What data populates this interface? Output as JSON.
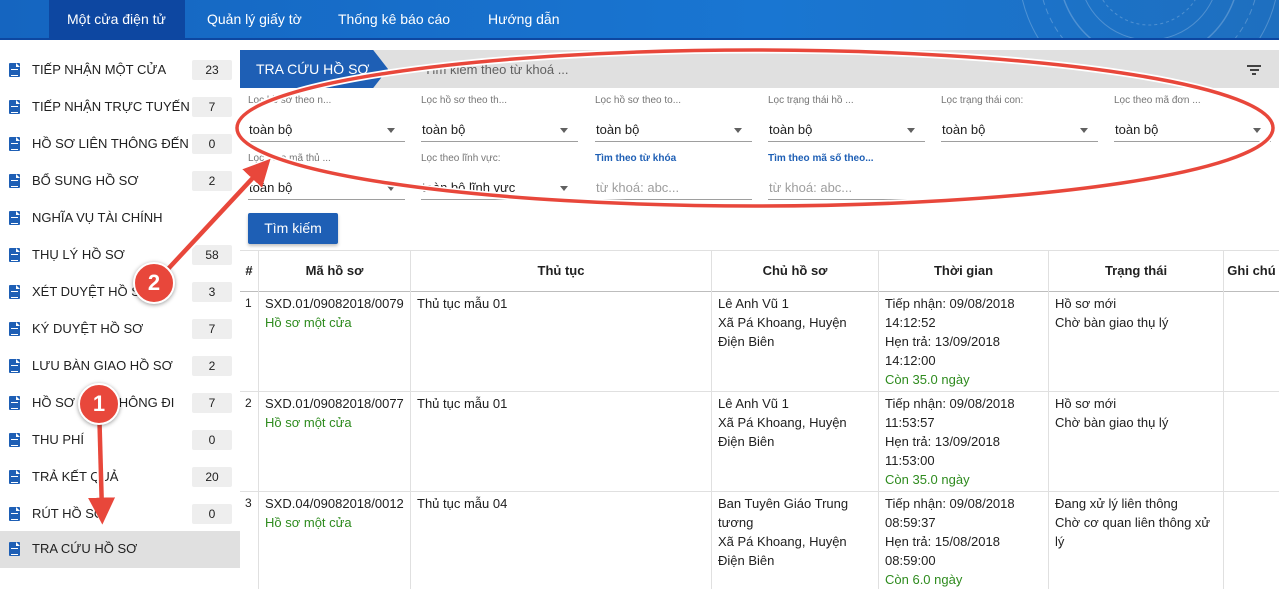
{
  "topnav": {
    "items": [
      "Một cửa điện tử",
      "Quản lý giấy tờ",
      "Thống kê báo cáo",
      "Hướng dẫn"
    ]
  },
  "sidebar": {
    "items": [
      {
        "label": "TIẾP NHẬN MỘT CỬA",
        "count": "23"
      },
      {
        "label": "TIẾP NHẬN TRỰC TUYẾN",
        "count": "7"
      },
      {
        "label": "HỒ SƠ LIÊN THÔNG ĐẾN",
        "count": "0"
      },
      {
        "label": "BỔ SUNG HỒ SƠ",
        "count": "2"
      },
      {
        "label": "NGHĨA VỤ TÀI CHÍNH",
        "count": ""
      },
      {
        "label": "THỤ LÝ HỒ SƠ",
        "count": "58"
      },
      {
        "label": "XÉT DUYỆT HỒ SƠ",
        "count": "3"
      },
      {
        "label": "KÝ DUYỆT HỒ SƠ",
        "count": "7"
      },
      {
        "label": "LƯU BÀN GIAO HỒ SƠ",
        "count": "2"
      },
      {
        "label": "HỒ SƠ LIÊN THÔNG ĐI",
        "count": "7"
      },
      {
        "label": "THU PHÍ",
        "count": "0"
      },
      {
        "label": "TRẢ KẾT QUẢ",
        "count": "20"
      },
      {
        "label": "RÚT HỒ SƠ",
        "count": "0"
      },
      {
        "label": "TRA CỨU HỒ SƠ",
        "count": ""
      }
    ]
  },
  "search": {
    "tag": "TRA CỨU HỒ SƠ",
    "placeholder": "Tìm kiếm theo từ khoá ..."
  },
  "filters": [
    {
      "label": "Lọc hồ sơ theo n...",
      "value": "toàn bộ",
      "type": "select"
    },
    {
      "label": "Lọc hồ sơ theo th...",
      "value": "toàn bộ",
      "type": "select"
    },
    {
      "label": "Lọc hồ sơ theo to...",
      "value": "toàn bộ",
      "type": "select"
    },
    {
      "label": "Lọc trạng thái hồ ...",
      "value": "toàn bộ",
      "type": "select"
    },
    {
      "label": "Lọc trạng thái con:",
      "value": "toàn bộ",
      "type": "select"
    },
    {
      "label": "Lọc theo mã đơn ...",
      "value": "toàn bộ",
      "type": "select"
    },
    {
      "label": "Lọc theo mã thủ ...",
      "value": "toàn bộ",
      "type": "select"
    },
    {
      "label": "Lọc theo lĩnh vực:",
      "value": "toàn bộ lĩnh vực",
      "type": "select"
    },
    {
      "label": "Tìm theo từ khóa",
      "value": "từ khoá: abc...",
      "type": "text"
    },
    {
      "label": "Tìm theo mã số theo...",
      "value": "từ khoá: abc...",
      "type": "text"
    }
  ],
  "search_button": "Tìm kiếm",
  "table": {
    "headers": [
      "#",
      "Mã hồ sơ",
      "Thủ tục",
      "Chủ hồ sơ",
      "Thời gian",
      "Trạng thái",
      "Ghi chú"
    ],
    "rows": [
      {
        "idx": "1",
        "code": "SXD.01/09082018/0079",
        "code_sub": "Hồ sơ một cửa",
        "procedure": "Thủ tục mẫu 01",
        "owner": "Lê Anh Vũ 1",
        "address": "Xã Pá Khoang, Huyện Điện Biên",
        "received": "Tiếp nhận: 09/08/2018 14:12:52",
        "due": "Hẹn trả: 13/09/2018 14:12:00",
        "remaining": "Còn 35.0 ngày",
        "status": "Hồ sơ mới",
        "substatus": "Chờ bàn giao thụ lý"
      },
      {
        "idx": "2",
        "code": "SXD.01/09082018/0077",
        "code_sub": "Hồ sơ một cửa",
        "procedure": "Thủ tục mẫu 01",
        "owner": "Lê Anh Vũ 1",
        "address": "Xã Pá Khoang, Huyện Điện Biên",
        "received": "Tiếp nhận: 09/08/2018 11:53:57",
        "due": "Hẹn trả: 13/09/2018 11:53:00",
        "remaining": "Còn 35.0 ngày",
        "status": "Hồ sơ mới",
        "substatus": "Chờ bàn giao thụ lý"
      },
      {
        "idx": "3",
        "code": "SXD.04/09082018/0012",
        "code_sub": "Hồ sơ một cửa",
        "procedure": "Thủ tục mẫu 04",
        "owner": "Ban Tuyên Giáo Trung tương",
        "address": "Xã Pá Khoang, Huyện Điện Biên",
        "received": "Tiếp nhận: 09/08/2018 08:59:37",
        "due": "Hẹn trả: 15/08/2018 08:59:00",
        "remaining": "Còn 6.0 ngày",
        "status": "Đang xử lý liên thông",
        "substatus": "Chờ cơ quan liên thông xử lý"
      }
    ]
  },
  "annotations": {
    "step1": "1",
    "step2": "2",
    "color": "#e8473b"
  },
  "colors": {
    "primary": "#1e5fb5",
    "nav": "#1976d2",
    "green": "#2e8b1e"
  }
}
